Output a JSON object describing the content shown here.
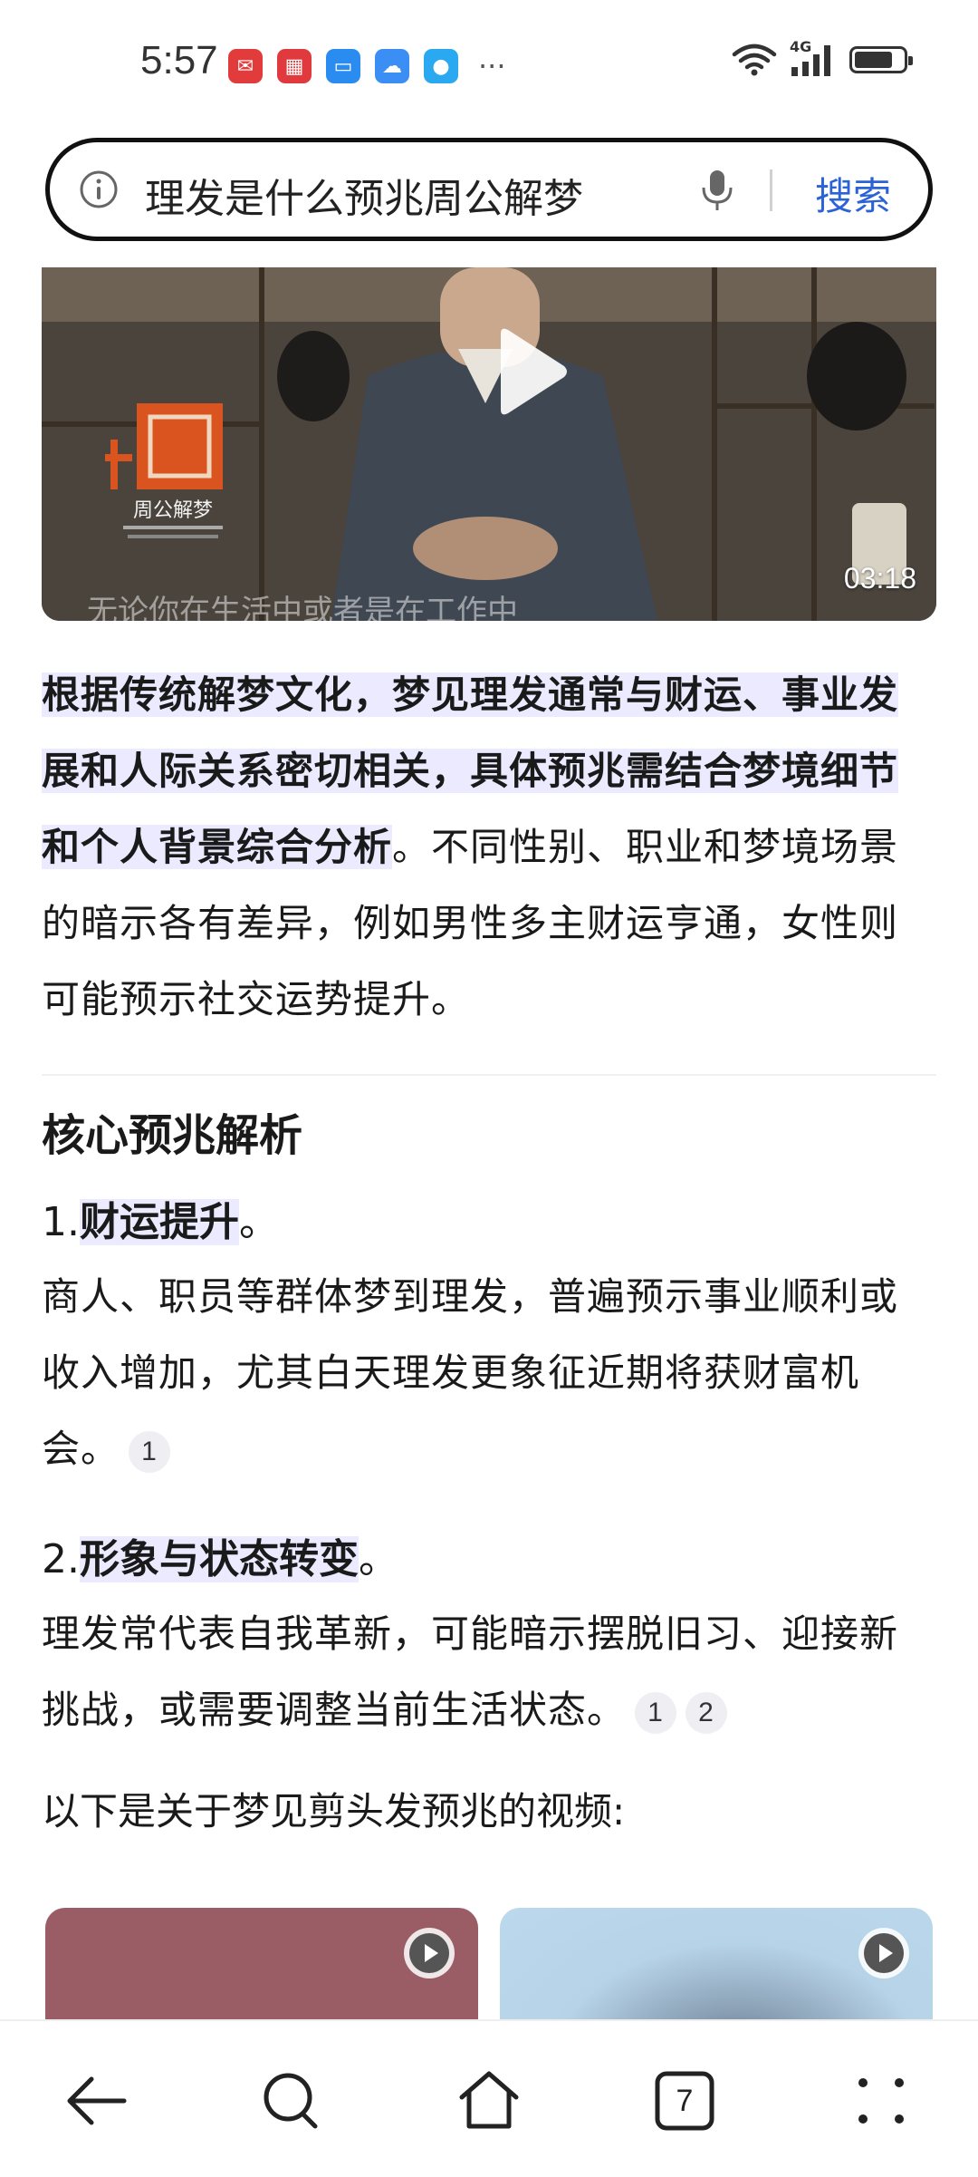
{
  "status_bar": {
    "time": "5:57",
    "network": "4G",
    "battery_level": 0.78,
    "notification_icons": [
      "mail-app-icon",
      "red-app-icon",
      "message-app-icon",
      "cloud-app-icon",
      "chat-app-icon"
    ],
    "more": "···"
  },
  "search": {
    "query": "理发是什么预兆周公解梦",
    "button_label": "搜索"
  },
  "video": {
    "duration": "03:18",
    "caption": "无论你在生活中或者是在工作中",
    "logo_text": "周公解梦"
  },
  "summary": {
    "highlight": "根据传统解梦文化，梦见理发通常与财运、事业发展和人际关系密切相关，具体预兆需结合梦境细节和个人背景综合分析",
    "rest": "。不同性别、职业和梦境场景的暗示各有差异，例如男性多主财运亨通，女性则可能预示社交运势提升。"
  },
  "section": {
    "title": "核心预兆解析",
    "items": [
      {
        "number": "1.",
        "title": "财运提升",
        "title_end": "。",
        "body": "商人、职员等群体梦到理发，普遍预示事业顺利或收入增加，尤其白天理发更象征近期将获财富机会。",
        "citations": [
          "1"
        ]
      },
      {
        "number": "2.",
        "title": "形象与状态转变",
        "title_end": "。",
        "body": "理发常代表自我革新，可能暗示摆脱旧习、迎接新挑战，或需要调整当前生活状态。",
        "citations": [
          "1",
          "2"
        ]
      }
    ],
    "video_intro": "以下是关于梦见剪头发预兆的视频:"
  },
  "bottom_nav": {
    "tab_count": "7"
  },
  "colors": {
    "accent": "#2b63d6",
    "highlight_bg": "#ebeaff",
    "thumb_left": "#9a5d66",
    "thumb_right": "#bcd8ec"
  }
}
